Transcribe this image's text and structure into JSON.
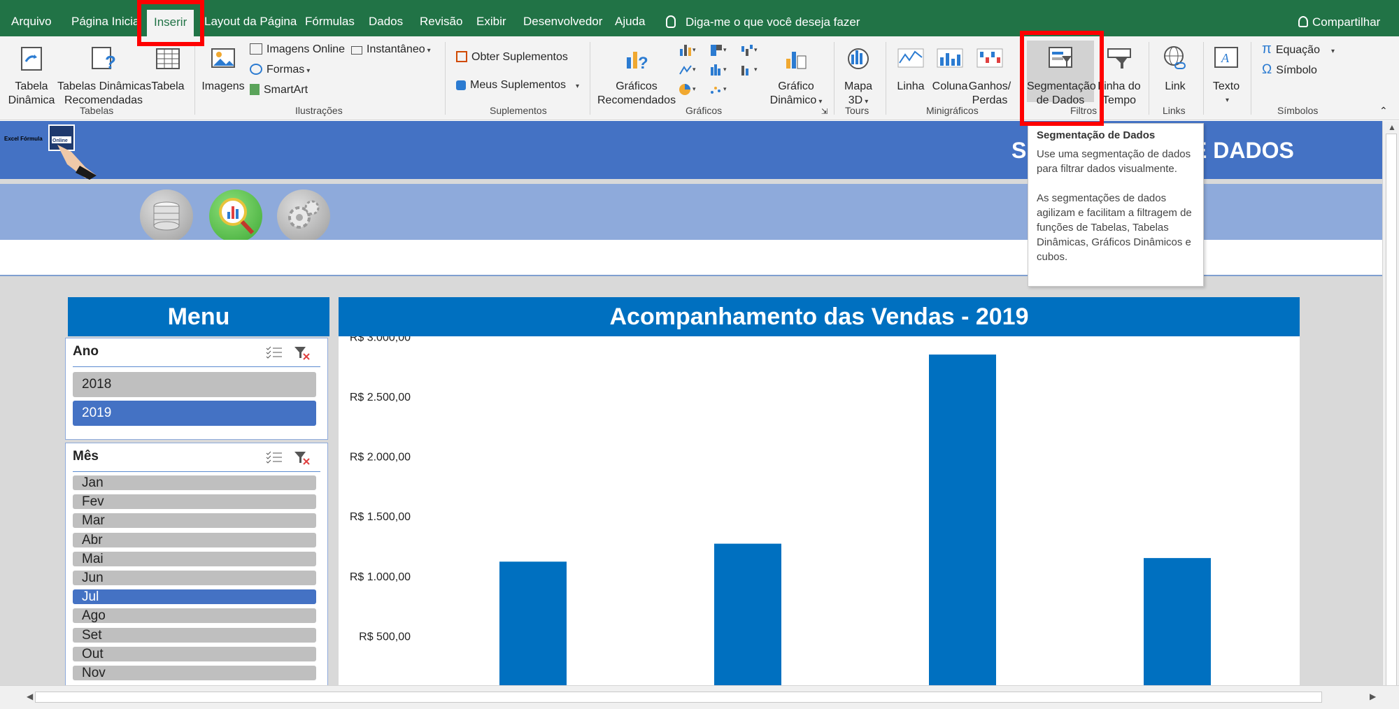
{
  "ribbon_tabs": [
    "Arquivo",
    "Página Inicial",
    "Inserir",
    "Layout da Página",
    "Fórmulas",
    "Dados",
    "Revisão",
    "Exibir",
    "Desenvolvedor",
    "Ajuda"
  ],
  "tell_me": "Diga-me o que você deseja fazer",
  "share": "Compartilhar",
  "groups": {
    "tabelas": "Tabelas",
    "ilustracoes": "Ilustrações",
    "suplementos": "Suplementos",
    "graficos": "Gráficos",
    "tours": "Tours",
    "minigraficos": "Minigráficos",
    "filtros": "Filtros",
    "links": "Links",
    "simbolos": "Símbolos"
  },
  "buttons": {
    "tabela_dinamica": [
      "Tabela",
      "Dinâmica"
    ],
    "tabelas_dinamicas_rec": [
      "Tabelas Dinâmicas",
      "Recomendadas"
    ],
    "tabela": "Tabela",
    "imagens": "Imagens",
    "imagens_online": "Imagens Online",
    "formas": "Formas",
    "smartart": "SmartArt",
    "instantaneo": "Instantâneo",
    "obter_suplementos": "Obter Suplementos",
    "meus_suplementos": "Meus Suplementos",
    "graficos_rec": [
      "Gráficos",
      "Recomendados"
    ],
    "grafico_dinamico": [
      "Gráfico",
      "Dinâmico"
    ],
    "mapa3d": [
      "Mapa",
      "3D"
    ],
    "linha": "Linha",
    "coluna": "Coluna",
    "ganhos_perdas": [
      "Ganhos/",
      "Perdas"
    ],
    "segmentacao": [
      "Segmentação",
      "de Dados"
    ],
    "linha_tempo": [
      "Linha do",
      "Tempo"
    ],
    "link": "Link",
    "texto": "Texto",
    "equacao": "Equação",
    "simbolo": "Símbolo"
  },
  "tooltip": {
    "title": "Segmentação de Dados",
    "p1": "Use uma segmentação de dados para filtrar dados visualmente.",
    "p2": "As segmentações de dados agilizam e facilitam a filtragem de funções de Tabelas, Tabelas Dinâmicas, Gráficos Dinâmicos e cubos."
  },
  "banner": {
    "title_left": "S",
    "title_right": "E DADOS",
    "logo_text": "Excel Fórmula",
    "logo_badge": "Online"
  },
  "menu_title": "Menu",
  "chart_title": "Acompanhamento das Vendas - 2019",
  "slicer_ano": {
    "title": "Ano",
    "items": [
      {
        "label": "2018",
        "selected": false
      },
      {
        "label": "2019",
        "selected": true
      }
    ]
  },
  "slicer_mes": {
    "title": "Mês",
    "items": [
      {
        "label": "Jan",
        "selected": false
      },
      {
        "label": "Fev",
        "selected": false
      },
      {
        "label": "Mar",
        "selected": false
      },
      {
        "label": "Abr",
        "selected": false
      },
      {
        "label": "Mai",
        "selected": false
      },
      {
        "label": "Jun",
        "selected": false
      },
      {
        "label": "Jul",
        "selected": true
      },
      {
        "label": "Ago",
        "selected": false
      },
      {
        "label": "Set",
        "selected": false
      },
      {
        "label": "Out",
        "selected": false
      },
      {
        "label": "Nov",
        "selected": false
      }
    ]
  },
  "colors": {
    "excel_green": "#217346",
    "banner_blue": "#4472c4",
    "light_band": "#8eaadb",
    "header_blue": "#0070c0",
    "selected": "#4472c4",
    "highlight": "#ff0000"
  },
  "chart_data": {
    "type": "bar",
    "title": "Acompanhamento das Vendas - 2019",
    "y_tick_labels": [
      "R$ 3.000,00",
      "R$ 2.500,00",
      "R$ 2.000,00",
      "R$ 1.500,00",
      "R$ 1.000,00",
      "R$ 500,00"
    ],
    "y_ticks": [
      3000,
      2500,
      2000,
      1500,
      1000,
      500
    ],
    "ylim": [
      0,
      3000
    ],
    "values": [
      1120,
      1270,
      2850,
      1150
    ],
    "grid": false,
    "legend": "none"
  }
}
